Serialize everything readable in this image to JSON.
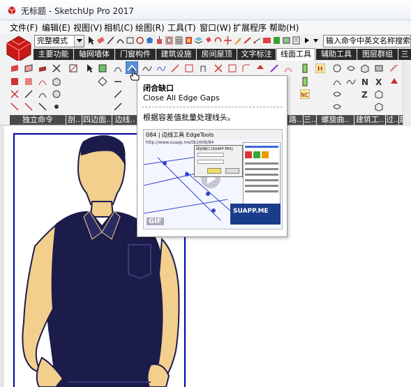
{
  "window": {
    "title": "无标题 - SketchUp Pro 2017"
  },
  "menubar": {
    "items": [
      "文件(F)",
      "编辑(E)",
      "视图(V)",
      "相机(C)",
      "绘图(R)",
      "工具(T)",
      "窗口(W)",
      "扩展程序",
      "帮助(H)"
    ]
  },
  "toolbar": {
    "style_select_value": "完整模式",
    "command_input_value": "输入命令中英文名称搜索"
  },
  "tabs": {
    "items": [
      "主要功能",
      "轴网墙体",
      "门窗构件",
      "建筑设施",
      "房间屋顶",
      "文字标注",
      "线面工具",
      "辅助工具",
      "图层群组",
      "三"
    ],
    "active": "线面工具"
  },
  "ribbon_groups": {
    "labels": [
      "独立命令",
      "剖..",
      "四边面..",
      "边线..",
      "路..",
      "三..",
      "螺旋曲..",
      "建筑工..",
      "过..",
      "封闭"
    ]
  },
  "tooltip": {
    "title": "闭合缺口",
    "subtitle": "Close All Edge Gaps",
    "description": "根据容差值批量处理线头。",
    "preview": {
      "header": "084 | 边线工具 EdgeTools",
      "url": "http://www.suapp.me/tb1608/84",
      "dialog_title": "闭合缺口 [SUAPP MIX]",
      "gif_badge": "GIF",
      "brand": "SUAPP.ME"
    }
  },
  "colors": {
    "tab_bar": "#2a2a2a",
    "group_label_bar": "#4a4a4a",
    "frame_line": "#0000aa",
    "shirt": "#1c1c4a",
    "skin": "#f3cf8e"
  }
}
